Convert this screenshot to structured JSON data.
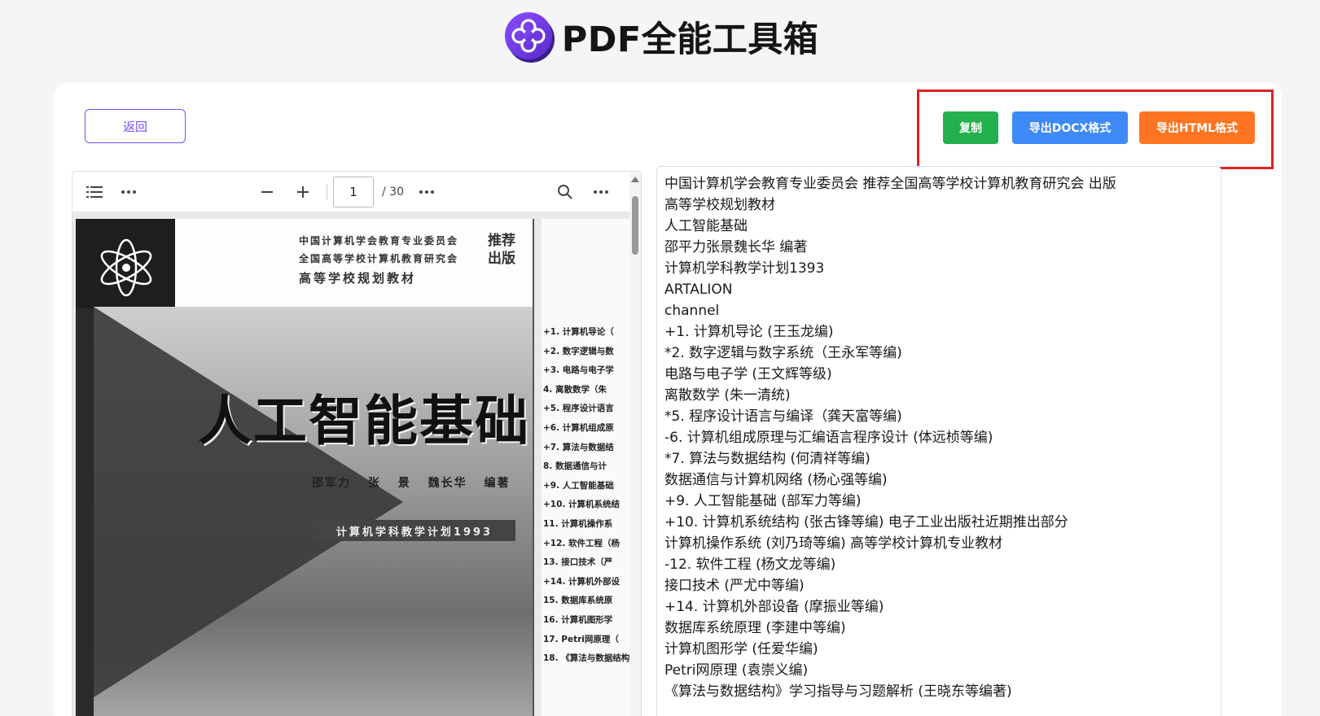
{
  "app": {
    "title": "PDF全能工具箱",
    "logo_icon": "flower-logo-icon"
  },
  "nav": {
    "back_label": "返回"
  },
  "actions": {
    "copy_label": "复制",
    "export_docx_label": "导出DOCX格式",
    "export_html_label": "导出HTML格式",
    "colors": {
      "copy": "#22b14c",
      "docx": "#3d8af7",
      "html": "#fd7522",
      "highlight_border": "#e32020"
    }
  },
  "viewer": {
    "current_page": "1",
    "total_pages": "/ 30",
    "toolbar_icons": [
      "sidebar-toggle-icon",
      "more-options-icon",
      "zoom-out-icon",
      "zoom-in-icon",
      "more-options-icon",
      "search-icon",
      "more-options-icon"
    ],
    "cover": {
      "publisher_lines": [
        "中国计算机学会教育专业委员会",
        "全国高等学校计算机教育研究会"
      ],
      "publisher_tag": [
        "推荐",
        "出版"
      ],
      "series": "高等学校规划教材",
      "title": "人工智能基础",
      "authors": "邵军力 张 景 魏长华 编著",
      "plan": "计算机学科教学计划1993"
    },
    "page2_toc": [
      "+1. 计算机导论（",
      "+2. 数字逻辑与数",
      "+3. 电路与电子学",
      "4. 离散数学（朱",
      "+5. 程序设计语言",
      "+6. 计算机组成原",
      "+7. 算法与数据结",
      "8. 数据通信与计",
      "+9. 人工智能基础",
      "+10. 计算机系统结",
      "11. 计算机操作系",
      "+12. 软件工程（杨",
      "13. 接口技术（严",
      "+14. 计算机外部设",
      "15. 数据库系统原",
      "16. 计算机图形学",
      "17. Petri网原理（",
      "18. 《算法与数据结构"
    ]
  },
  "extracted_text": [
    "中国计算机学会教育专业委员会 推荐全国高等学校计算机教育研究会 出版",
    "高等学校规划教材",
    "人工智能基础",
    "邵平力张景魏长华 编著",
    "计算机学科教学计划1393",
    "ARTALION",
    "channel",
    "+1. 计算机导论 (王玉龙编)",
    "*2. 数字逻辑与数字系统（王永军等编)",
    "电路与电子学 (王文辉等级)",
    "离散数学 (朱一清统)",
    "*5. 程序设计语言与编译（龚天富等编)",
    "-6. 计算机组成原理与汇编语言程序设计 (体远桢等编)",
    "*7. 算法与数据结构 (何清祥等编)",
    "数据通信与计算机网络 (杨心强等编)",
    "+9. 人工智能基础 (部军力等编)",
    "+10. 计算机系统结构 (张古锋等编) 电子工业出版社近期推出部分",
    "计算机操作系统 (刘乃琦等编) 高等学校计算机专业教材",
    "-12. 软件工程 (杨文龙等编)",
    "接口技术 (严尤中等编)",
    "+14. 计算机外部设备 (摩振业等编)",
    "数据库系统原理 (李建中等编)",
    "计算机图形学 (任爱华编)",
    "Petri网原理 (袁崇义编)",
    "《算法与数据结构》学习指导与习题解析 (王晓东等编著)"
  ]
}
